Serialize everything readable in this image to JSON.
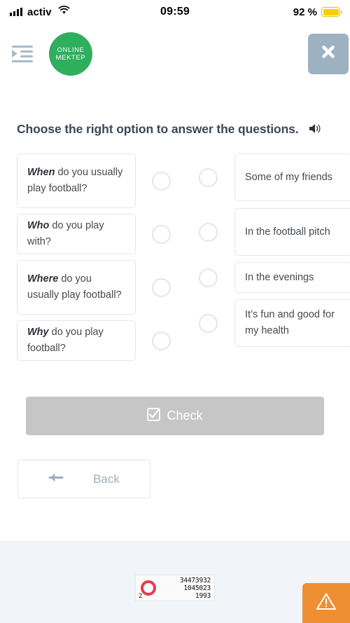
{
  "status_bar": {
    "carrier": "activ",
    "time": "09:59",
    "battery_percent": "92 %",
    "signal_icon": "signal-bars-icon",
    "wifi_icon": "wifi-icon",
    "battery_icon": "battery-icon"
  },
  "header": {
    "menu_icon": "indent-menu-icon",
    "logo_line1": "ONLINE",
    "logo_line2": "MEKTEP",
    "close_icon": "close-x-icon"
  },
  "main": {
    "instruction": "Choose the right option to answer the questions.",
    "speaker_icon": "speaker-sound-icon",
    "questions": [
      {
        "bold": "When",
        "rest": " do you usually play football?"
      },
      {
        "bold": "Who",
        "rest": " do you play with?"
      },
      {
        "bold": "Where",
        "rest": " do you usually play football?"
      },
      {
        "bold": "Why",
        "rest": " do you play football?"
      }
    ],
    "answers": [
      "Some of my friends",
      "In the football pitch",
      "In the evenings",
      "It’s fun and good for my health"
    ]
  },
  "actions": {
    "check_label": "Check",
    "check_icon": "checkbox-checked-icon",
    "check_disabled": true,
    "back_label": "Back",
    "back_icon": "arrow-left-icon"
  },
  "footer": {
    "counter": {
      "total": "34473932",
      "today": "1045023",
      "online": "1993",
      "badge": "2"
    },
    "warning_icon": "warning-triangle-icon"
  },
  "colors": {
    "logo_green": "#2fae5e",
    "close_gray_blue": "#9cb2c0",
    "check_disabled_gray": "#c6c6c6",
    "back_text": "#9fb0bd",
    "instruction_text": "#3c4858",
    "footer_bg": "#f1f5f9",
    "warning_orange": "#ef8f34",
    "counter_red": "#e83a4f",
    "battery_yellow": "#fccc00"
  }
}
